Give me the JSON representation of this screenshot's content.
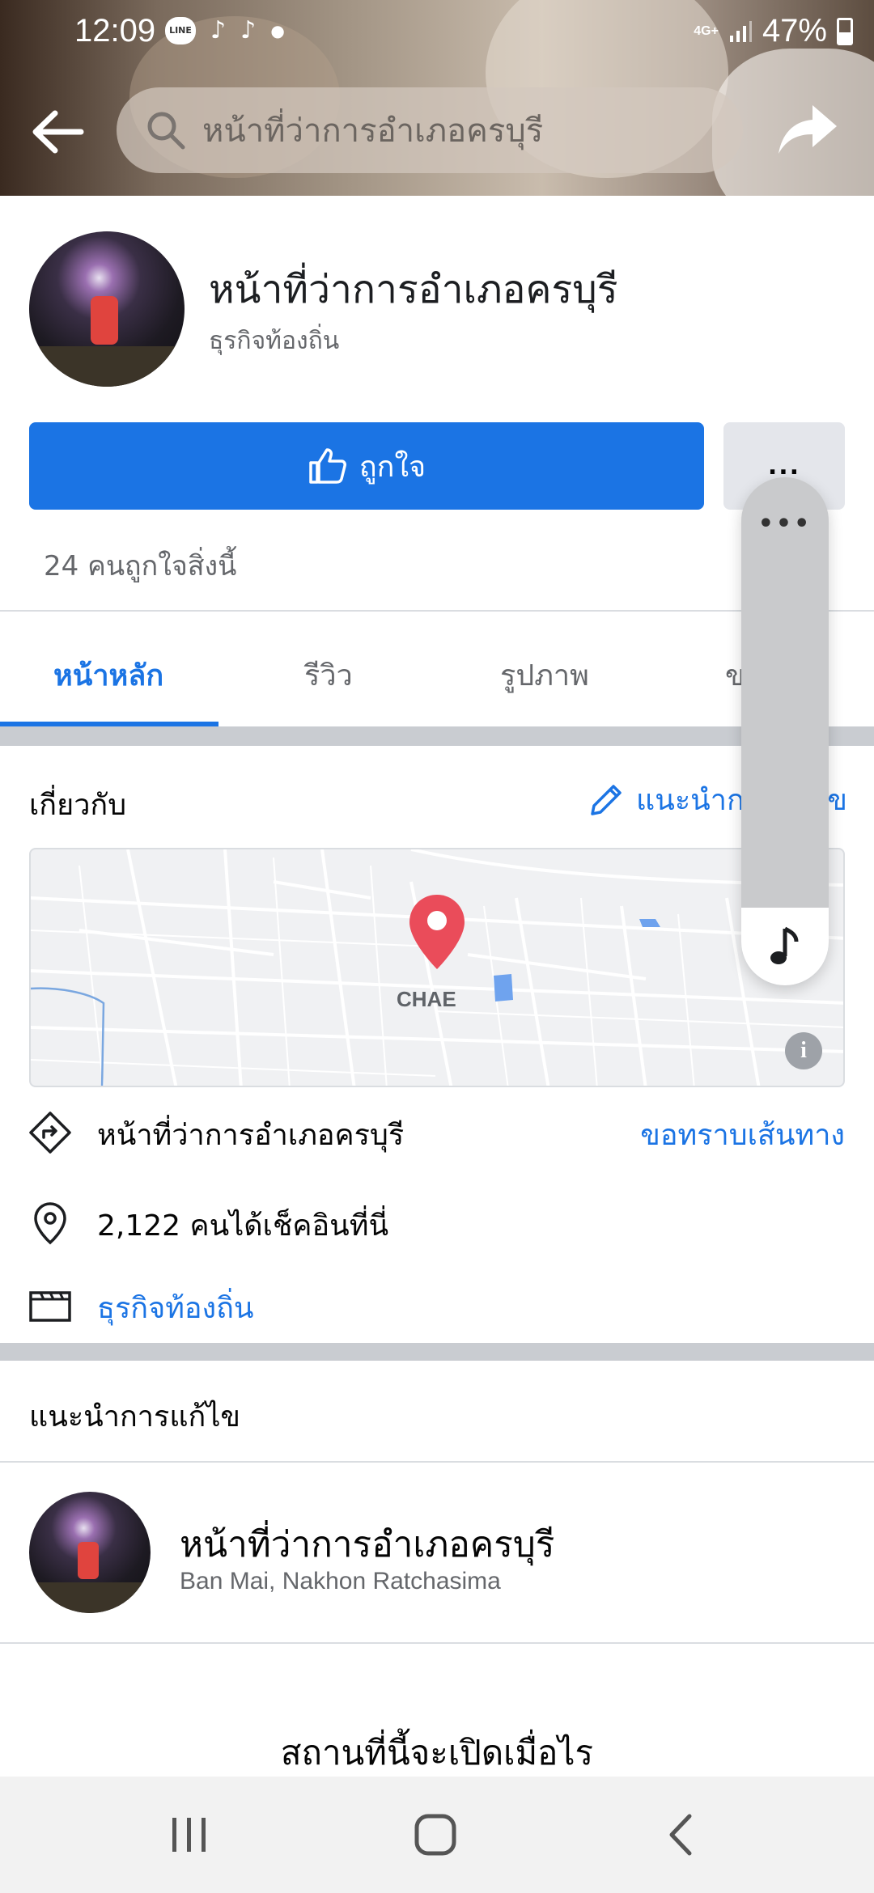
{
  "status_bar": {
    "time": "12:09",
    "line_label": "LINE",
    "network": "4G+",
    "battery": "47%"
  },
  "header": {
    "search_text": "หน้าที่ว่าการอำเภอครบุรี"
  },
  "profile": {
    "name": "หน้าที่ว่าการอำเภอครบุรี",
    "category": "ธุรกิจท้องถิ่น",
    "like_button": "ถูกใจ",
    "more_button": "...",
    "like_count": "24 คนถูกใจสิ่งนี้"
  },
  "tabs": [
    {
      "label": "หน้าหลัก",
      "active": true
    },
    {
      "label": "รีวิว",
      "active": false
    },
    {
      "label": "รูปภาพ",
      "active": false
    },
    {
      "label": "ข",
      "active": false
    }
  ],
  "about": {
    "title": "เกี่ยวกับ",
    "suggest_edit": "แนะนำการแก้ไข",
    "map_label": "CHAE",
    "map_info": "i",
    "rows": [
      {
        "icon": "directions-icon",
        "text": "หน้าที่ว่าการอำเภอครบุรี",
        "action": "ขอทราบเส้นทาง"
      },
      {
        "icon": "location-pin-icon",
        "text": "2,122 คนได้เช็คอินที่นี่"
      },
      {
        "icon": "category-icon",
        "text": "ธุรกิจท้องถิ่น"
      }
    ]
  },
  "edits": {
    "title": "แนะนำการแก้ไข",
    "suggestion_name": "หน้าที่ว่าการอำเภอครบุรี",
    "suggestion_location": "Ban Mai, Nakhon Ratchasima"
  },
  "open_hours_title": "สถานที่นี้จะเปิดเมื่อไร",
  "floating_widget": {
    "dots": "•••"
  },
  "colors": {
    "accent": "#1b74e4",
    "map_pin": "#ea4c5a"
  }
}
